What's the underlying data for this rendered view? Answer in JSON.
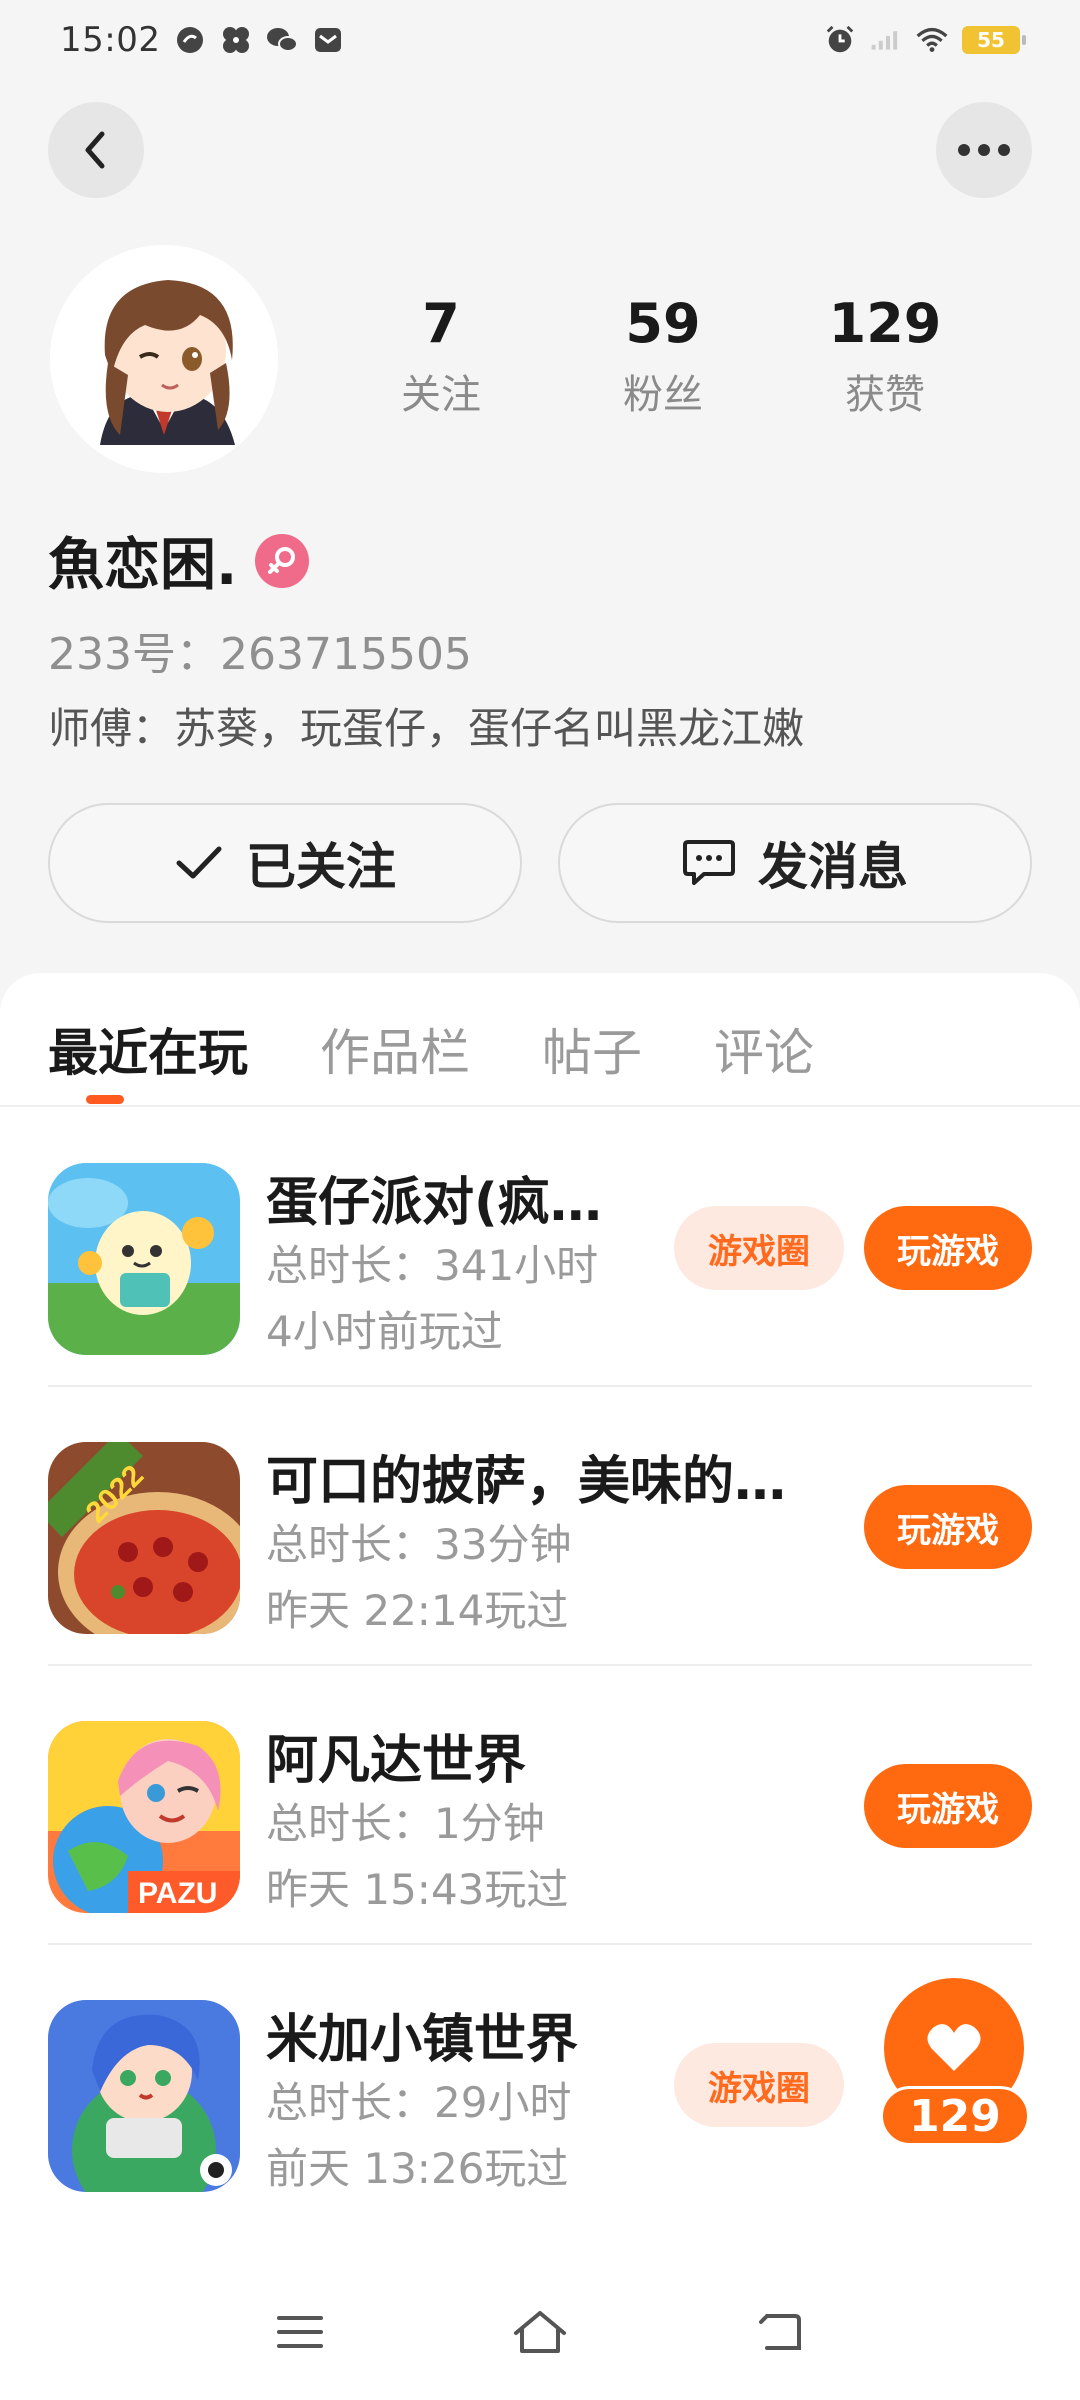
{
  "status_bar": {
    "time": "15:02",
    "battery": "55",
    "left_icons": [
      "ring-icon",
      "pinwheel-icon",
      "wechat-icon",
      "message-icon"
    ],
    "right_icons": [
      "alarm-icon",
      "signal-icon",
      "wifi-icon",
      "battery-icon"
    ]
  },
  "profile": {
    "stats": [
      {
        "value": "7",
        "label": "关注"
      },
      {
        "value": "59",
        "label": "粉丝"
      },
      {
        "value": "129",
        "label": "获赞"
      }
    ],
    "username": "魚恋困.",
    "gender_icon": "female-icon",
    "uid": "233号：263715505",
    "bio": "师傅：苏葵，玩蛋仔，蛋仔名叫黑龙江嫩"
  },
  "actions": {
    "follow_label": "已关注",
    "message_label": "发消息"
  },
  "tabs": [
    {
      "label": "最近在玩",
      "active": true
    },
    {
      "label": "作品栏",
      "active": false
    },
    {
      "label": "帖子",
      "active": false
    },
    {
      "label": "评论",
      "active": false
    }
  ],
  "games": [
    {
      "title": "蛋仔派对(疯…",
      "duration": "总时长：341小时",
      "last_played": "4小时前玩过",
      "circle_label": "游戏圈",
      "play_label": "玩游戏",
      "icon": "eggy-party-icon"
    },
    {
      "title": "可口的披萨，美味的…",
      "duration": "总时长：33分钟",
      "last_played": "昨天 22:14玩过",
      "play_label": "玩游戏",
      "icon": "pizza-icon",
      "icon_badge": "2022"
    },
    {
      "title": "阿凡达世界",
      "duration": "总时长：1分钟",
      "last_played": "昨天 15:43玩过",
      "play_label": "玩游戏",
      "icon": "avatar-world-icon",
      "icon_badge": "PAZU"
    },
    {
      "title": "米加小镇世界",
      "duration": "总时长：29小时",
      "last_played": "前天 13:26玩过",
      "circle_label": "游戏圈",
      "icon": "miga-town-icon"
    }
  ],
  "floating_like": {
    "count": "129"
  },
  "colors": {
    "accent": "#ff6a10",
    "accent_soft": "#fde9df",
    "female": "#f06b8a"
  }
}
